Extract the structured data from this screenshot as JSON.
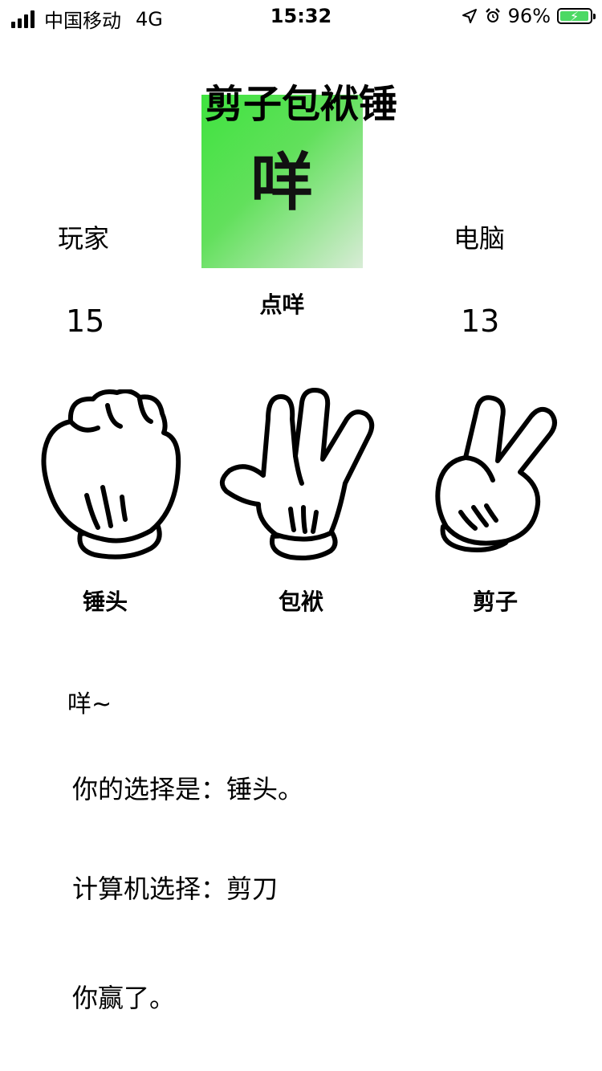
{
  "status_bar": {
    "carrier": "中国移动",
    "network": "4G",
    "time": "15:32",
    "battery": "96%",
    "battery_level": 0.96,
    "icons": [
      "signal-icon",
      "location-arrow-icon",
      "alarm-icon",
      "battery-icon"
    ]
  },
  "game": {
    "title": "剪子包袱锤",
    "center_button": "咩",
    "center_caption": "点咩",
    "player_label": "玩家",
    "computer_label": "电脑",
    "player_score": "15",
    "computer_score": "13"
  },
  "choices": [
    {
      "label": "锤头",
      "icon": "fist-icon"
    },
    {
      "label": "包袱",
      "icon": "open-hand-icon"
    },
    {
      "label": "剪子",
      "icon": "scissors-hand-icon"
    }
  ],
  "result": {
    "sound": "咩~",
    "player_choice": "你的选择是：锤头。",
    "computer_choice": "计算机选择：剪刀",
    "outcome": "你赢了。"
  },
  "colors": {
    "tile_green": "#3fe33f",
    "battery_green": "#4cd964"
  }
}
